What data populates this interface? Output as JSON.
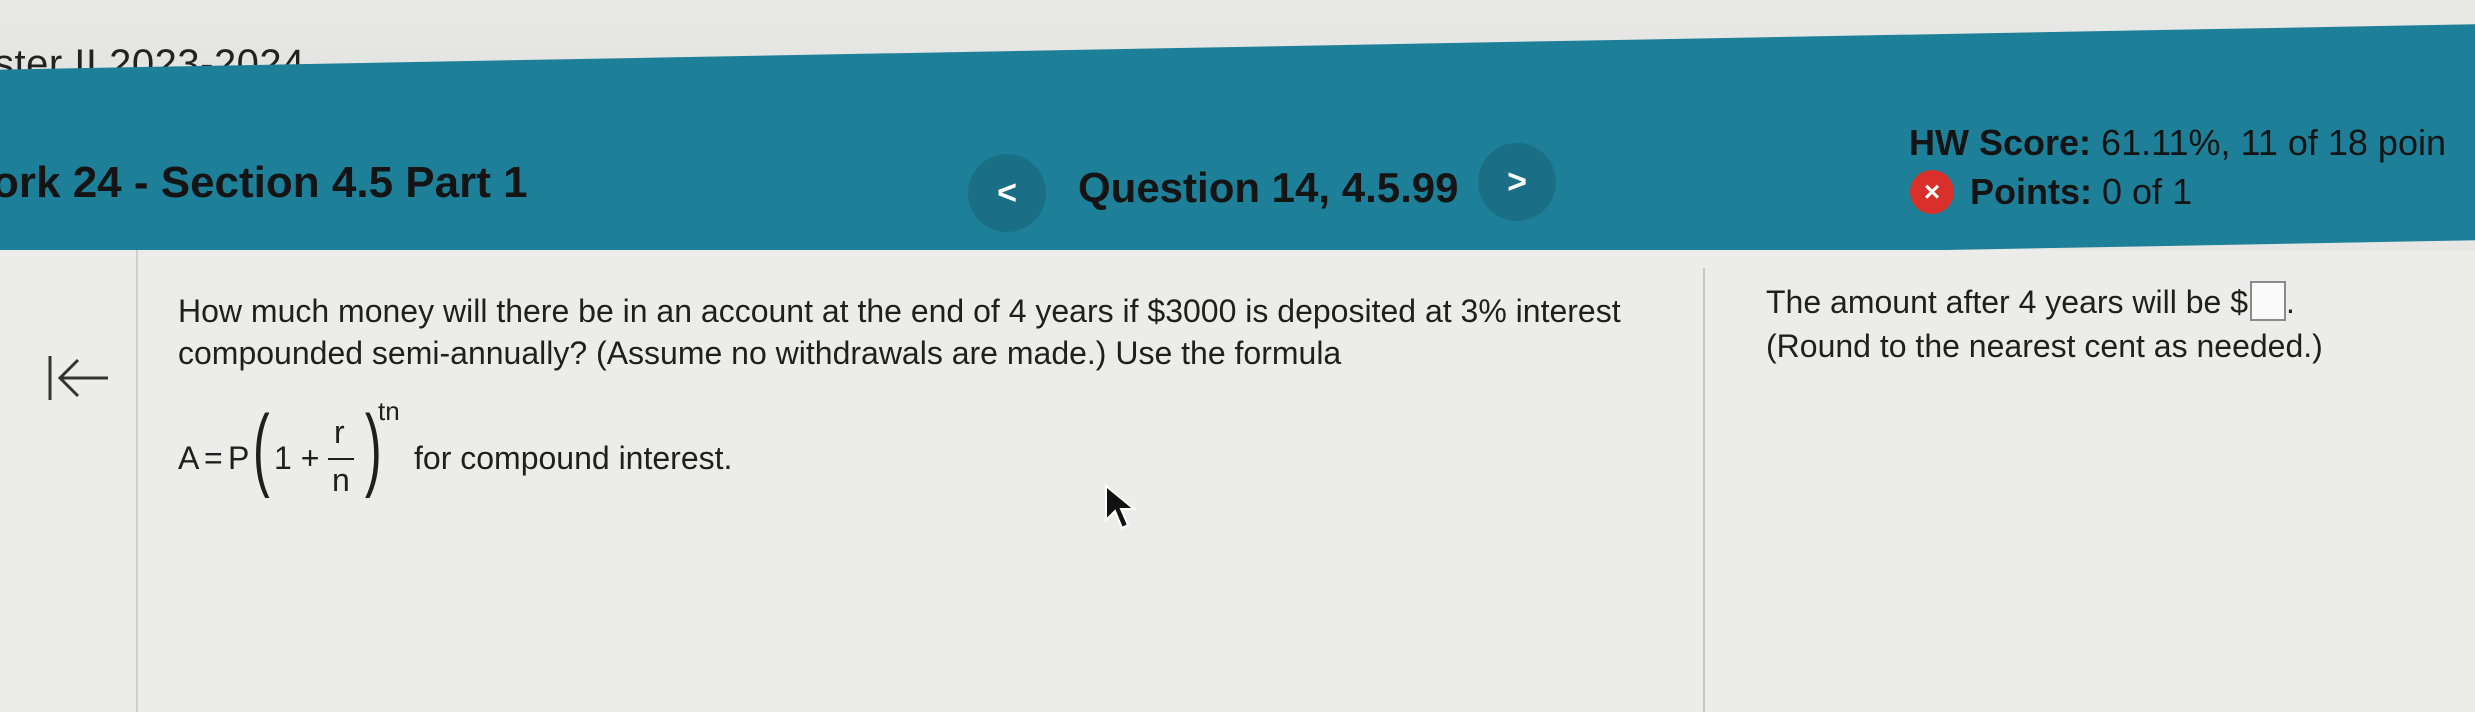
{
  "course": {
    "title": "ster II 2023-2024"
  },
  "header": {
    "homework_title": "ork 24 - Section 4.5 Part 1",
    "question_label": "Question 14, 4.5.99",
    "prev_label": "<",
    "next_label": ">",
    "hw_score_label": "HW Score:",
    "hw_score_value": "61.11%, 11 of 18 poin",
    "points_label": "Points:",
    "points_value": "0 of 1",
    "points_status_icon": "incorrect-x-icon",
    "accent_color": "#1e7f99",
    "status_color": "#d9302c"
  },
  "question": {
    "text": "How much money will there be in an account at the end of 4 years if $3000 is deposited at 3% interest compounded semi-annually? (Assume no withdrawals are made.) Use the formula",
    "formula": {
      "lhs": "A",
      "equals": "=",
      "P": "P",
      "one_plus": "1 +",
      "numerator": "r",
      "denominator": "n",
      "exponent": "tn"
    },
    "formula_suffix": "for compound interest."
  },
  "answer": {
    "prefix": "The amount after 4 years will be $",
    "suffix": ".",
    "input_value": "",
    "hint": "(Round to the nearest cent as needed.)"
  }
}
